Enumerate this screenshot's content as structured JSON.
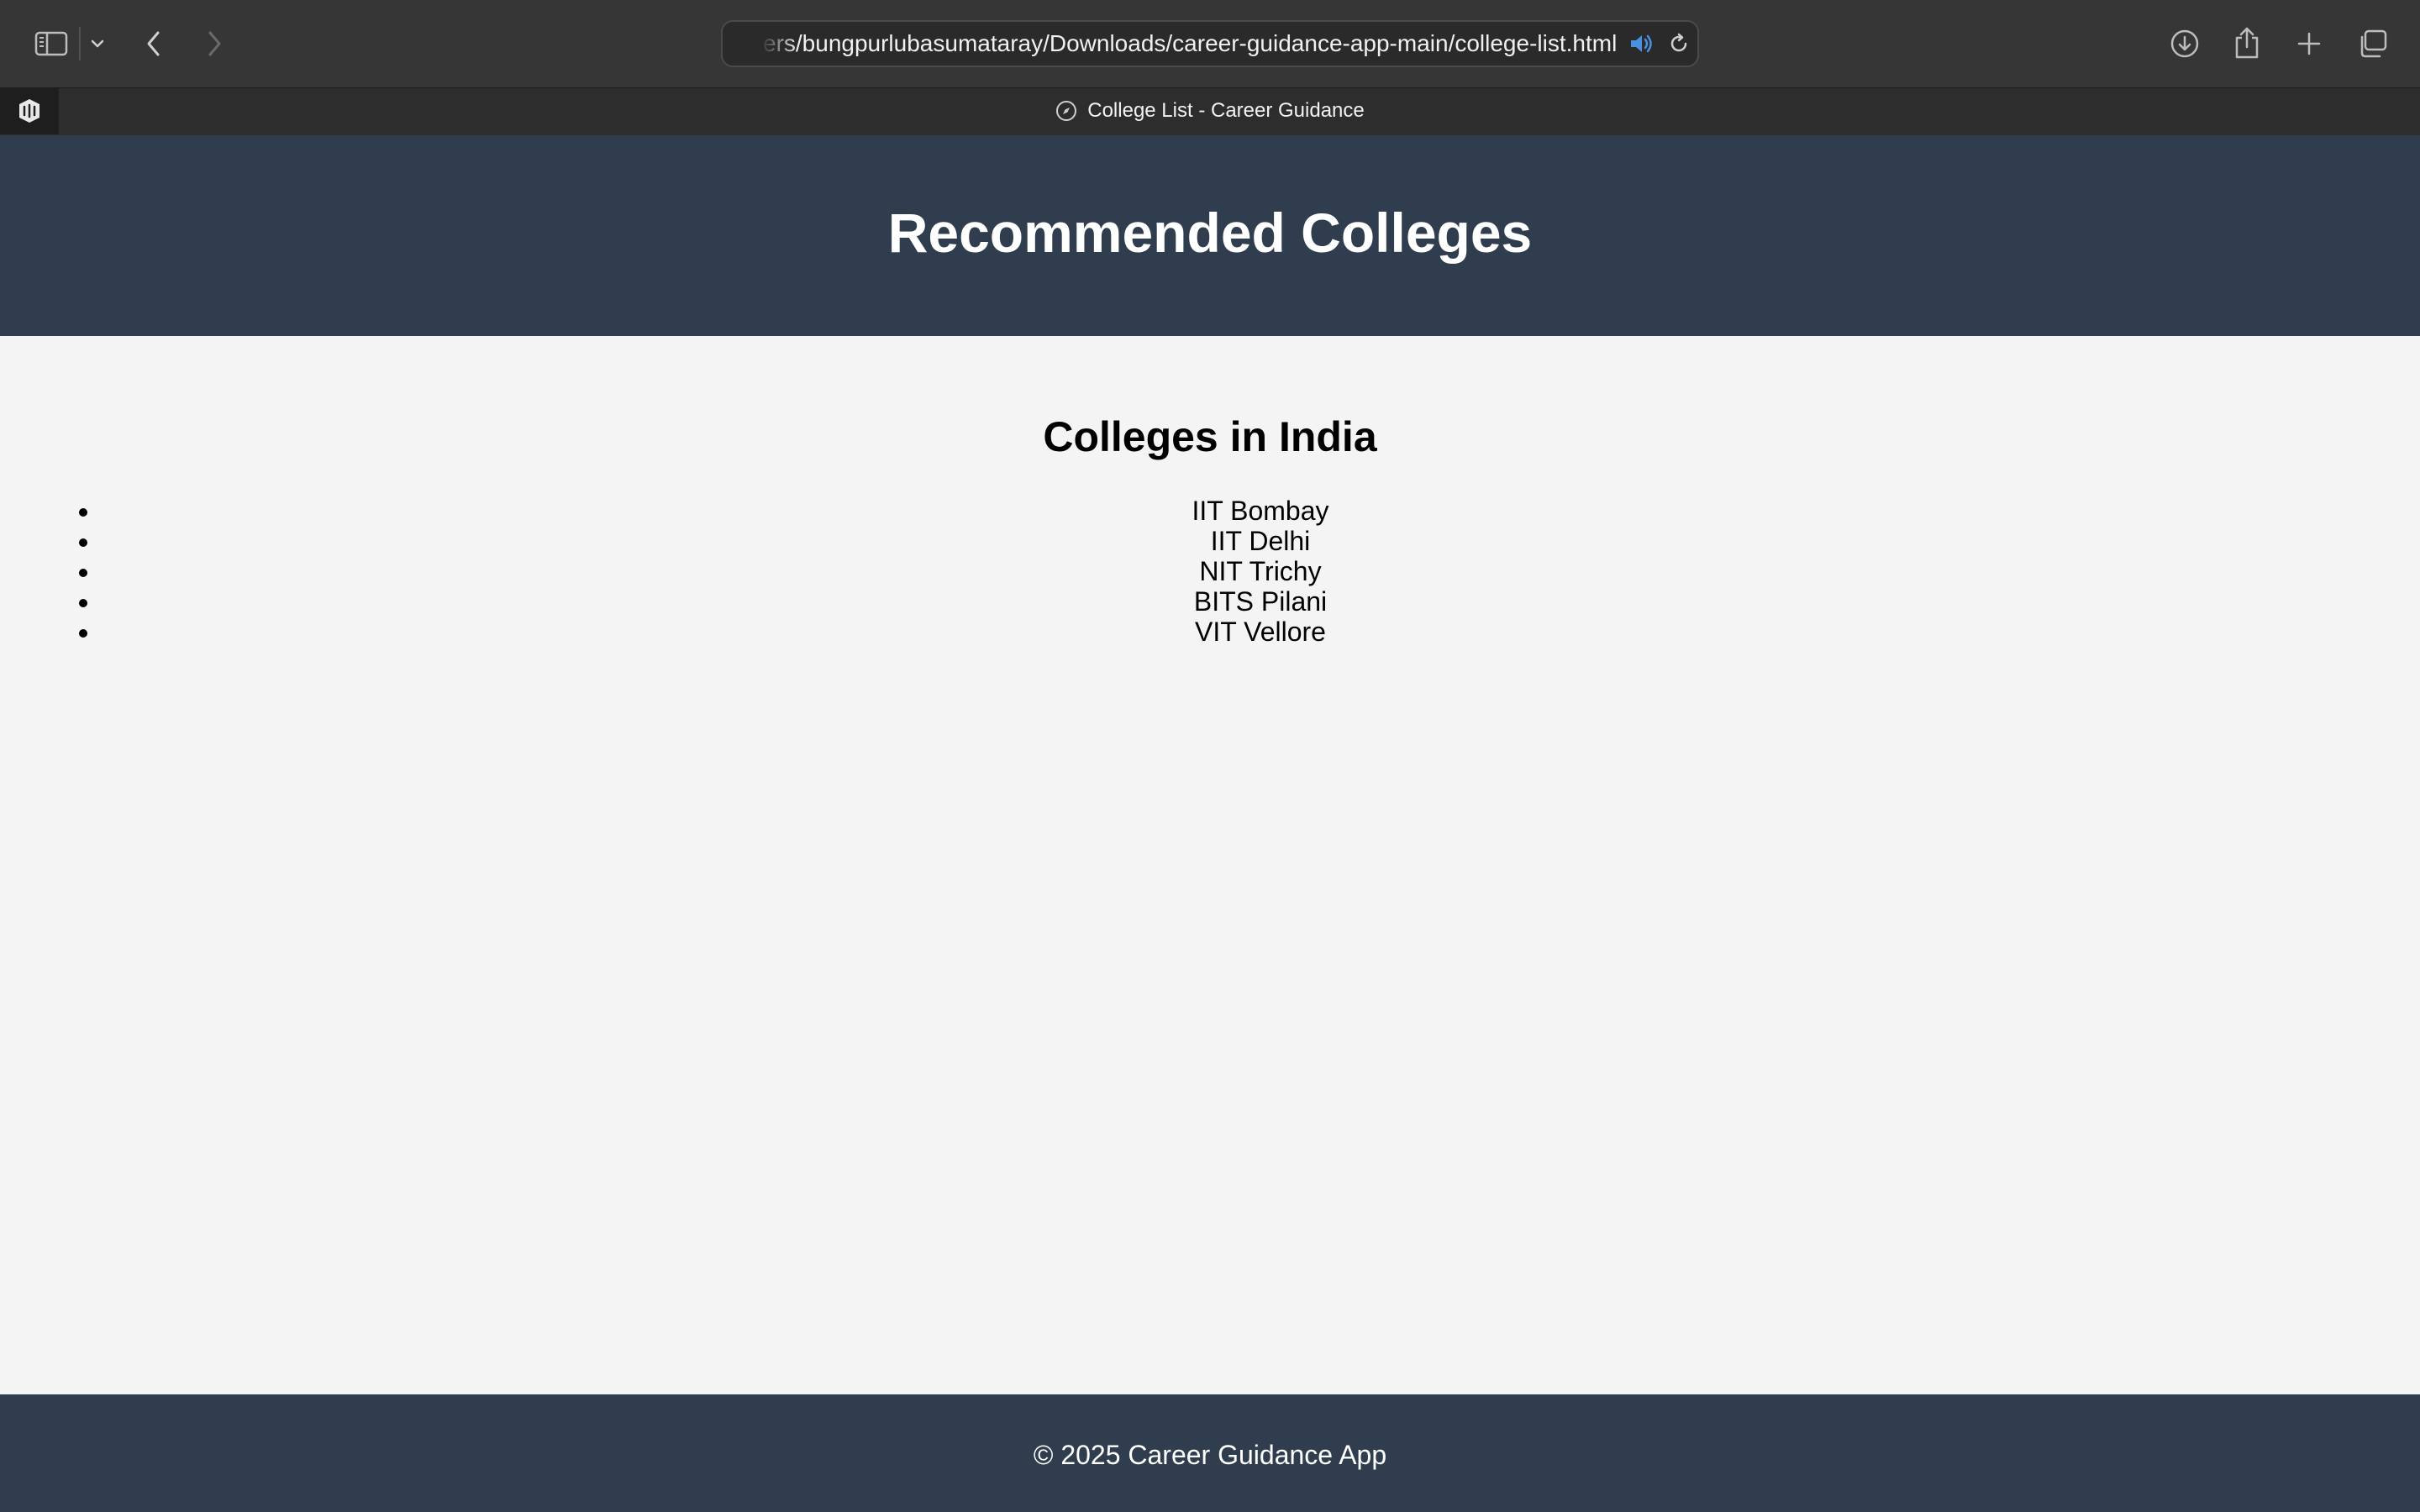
{
  "browser": {
    "url": "ers/bungpurlubasumataray/Downloads/career-guidance-app-main/college-list.html",
    "tab_title": "College List - Career Guidance",
    "icons": {
      "sidebar": "sidebar-icon",
      "sidebar_menu": "chevron-down-icon",
      "back": "chevron-left-icon",
      "forward": "chevron-right-icon",
      "audio": "speaker-icon",
      "reload": "reload-icon",
      "downloads": "download-icon",
      "share": "share-icon",
      "new_tab": "plus-icon",
      "tab_overview": "tabs-overview-icon",
      "extension": "extension-icon",
      "favicon": "compass-icon"
    }
  },
  "page": {
    "header_title": "Recommended Colleges",
    "section_title": "Colleges in India",
    "colleges": [
      "IIT Bombay",
      "IIT Delhi",
      "NIT Trichy",
      "BITS Pilani",
      "VIT Vellore"
    ],
    "footer_text": "© 2025 Career Guidance App"
  },
  "colors": {
    "header_bg": "#2f3d4f",
    "page_bg": "#f4f4f4",
    "toolbar_bg": "#363636",
    "audio_accent": "#4a90e2"
  }
}
